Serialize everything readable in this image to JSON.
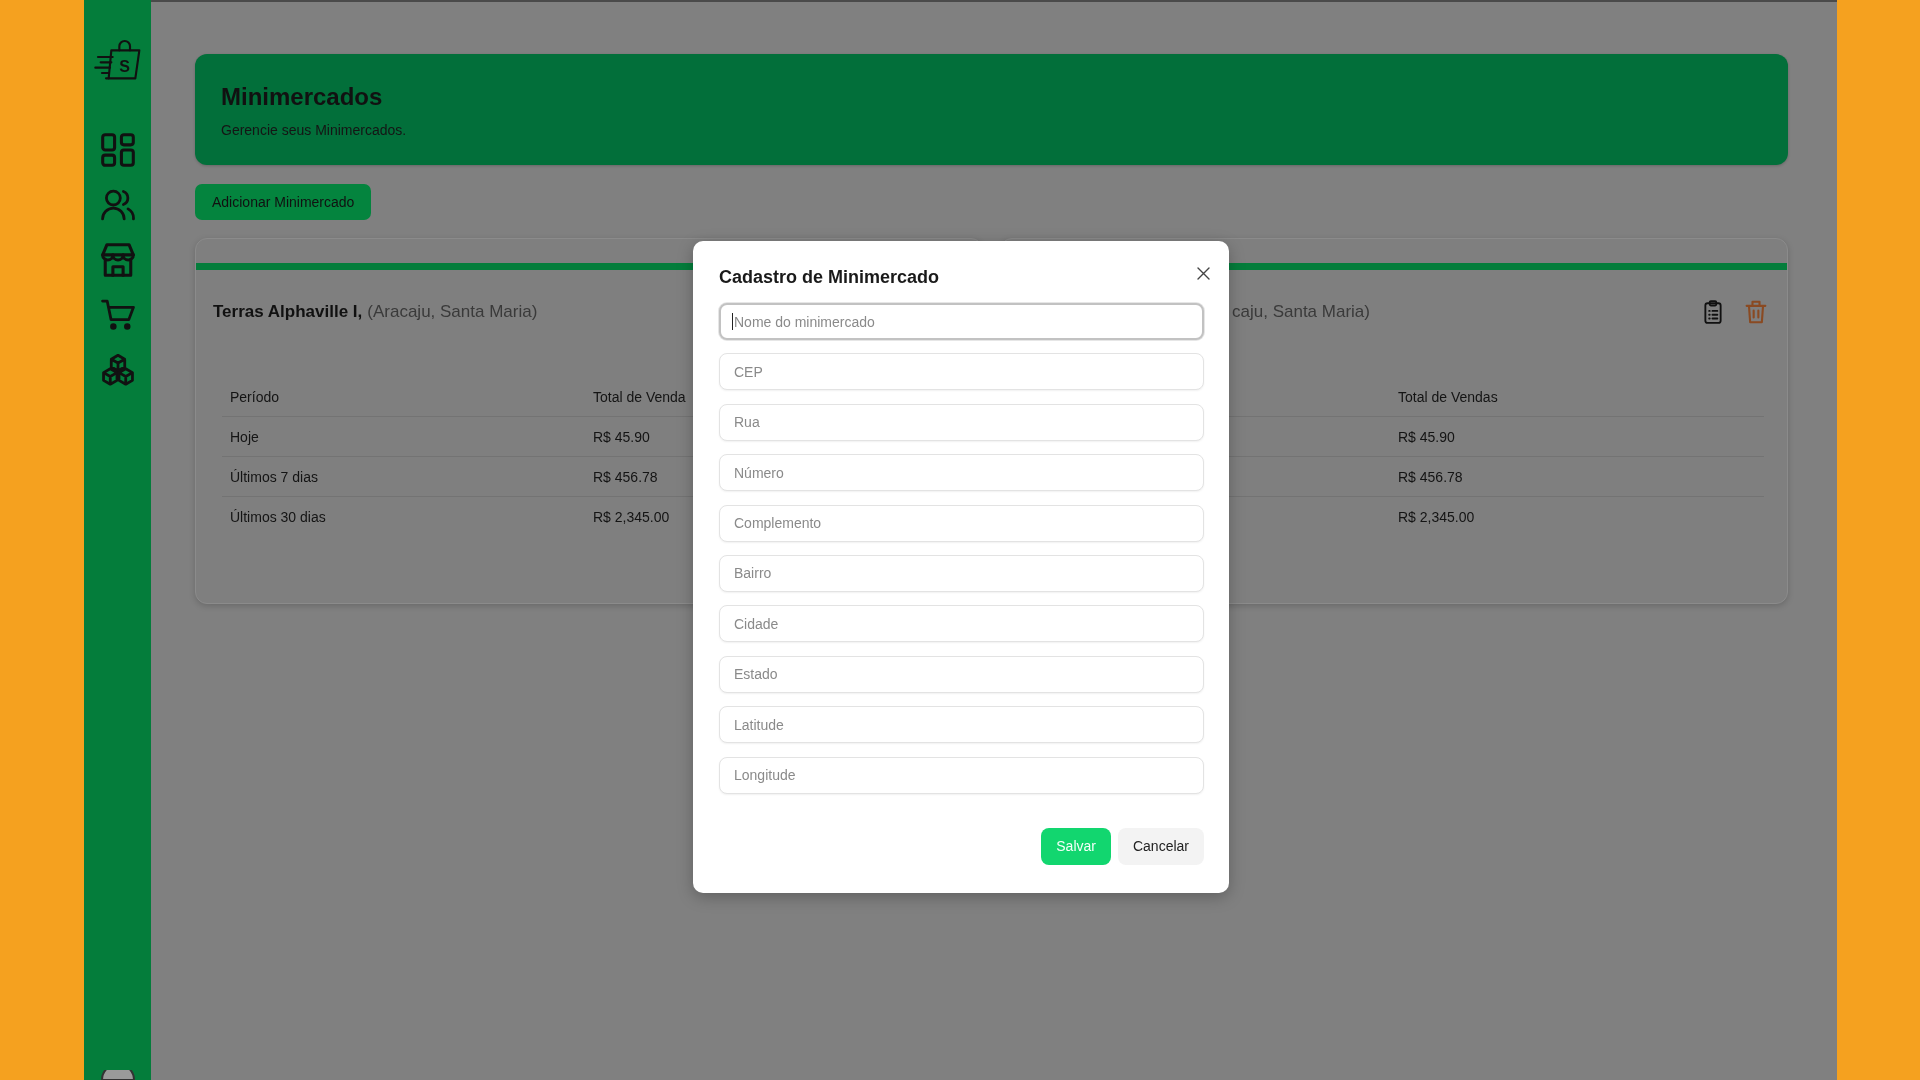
{
  "sidebar": {
    "logo_letter": "S"
  },
  "header": {
    "title": "Minimercados",
    "subtitle": "Gerencie seus Minimercados."
  },
  "add_button": {
    "label": "Adicionar Minimercado"
  },
  "stores": [
    {
      "kind": "covered-right",
      "name": "Terras Alphaville I,",
      "location": "(Aracaju, Santa Maria)",
      "columns": {
        "period": "Período",
        "total": "Total de Venda"
      },
      "rows": [
        {
          "period": "Hoje",
          "total": "R$ 45.90"
        },
        {
          "period": "Últimos 7 dias",
          "total": "R$ 456.78"
        },
        {
          "period": "Últimos 30 dias",
          "total": "R$ 2,345.00"
        }
      ]
    },
    {
      "kind": "covered-left",
      "location": "caju, Santa Maria)",
      "columns": {
        "total": "Total de Vendas"
      },
      "rows": [
        {
          "total": "R$ 45.90"
        },
        {
          "total": "R$ 456.78"
        },
        {
          "total": "R$ 2,345.00"
        }
      ]
    }
  ],
  "modal": {
    "title": "Cadastro de Minimercado",
    "fields": [
      {
        "placeholder": "Nome do minimercado",
        "focused": true
      },
      {
        "placeholder": "CEP",
        "focused": false
      },
      {
        "placeholder": "Rua",
        "focused": false
      },
      {
        "placeholder": "Número",
        "focused": false
      },
      {
        "placeholder": "Complemento",
        "focused": false
      },
      {
        "placeholder": "Bairro",
        "focused": false
      },
      {
        "placeholder": "Cidade",
        "focused": false
      },
      {
        "placeholder": "Estado",
        "focused": false
      },
      {
        "placeholder": "Latitude",
        "focused": false
      },
      {
        "placeholder": "Longitude",
        "focused": false
      }
    ],
    "buttons": [
      {
        "label": "Salvar",
        "kind": "primary"
      },
      {
        "label": "Cancelar",
        "kind": "secondary"
      }
    ]
  }
}
